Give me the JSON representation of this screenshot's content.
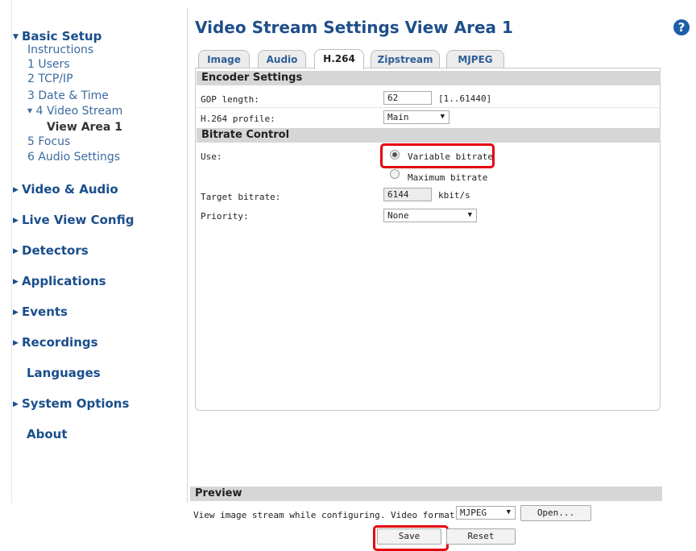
{
  "sidebar": {
    "basic_setup": "Basic Setup",
    "sub_items": [
      "Instructions",
      "1 Users",
      "2 TCP/IP",
      "3 Date & Time",
      "4 Video Stream",
      "View Area 1",
      "5 Focus",
      "6 Audio Settings"
    ],
    "sections": [
      "Video & Audio",
      "Live View Config",
      "Detectors",
      "Applications",
      "Events",
      "Recordings",
      "Languages",
      "System Options",
      "About"
    ]
  },
  "header": {
    "title": "Video Stream Settings View Area 1",
    "help": "?"
  },
  "tabs": [
    "Image",
    "Audio",
    "H.264",
    "Zipstream",
    "MJPEG"
  ],
  "active_tab": "H.264",
  "encoder": {
    "heading": "Encoder Settings",
    "gop_label": "GOP length:",
    "gop_value": "62",
    "gop_range": "[1..61440]",
    "profile_label": "H.264 profile:",
    "profile_value": "Main"
  },
  "bitrate": {
    "heading": "Bitrate Control",
    "use_label": "Use:",
    "variable_label": "Variable bitrate",
    "maximum_label": "Maximum bitrate",
    "selected": "Variable bitrate",
    "target_label": "Target bitrate:",
    "target_value": "6144",
    "target_unit": "kbit/s",
    "priority_label": "Priority:",
    "priority_value": "None"
  },
  "preview": {
    "heading": "Preview",
    "text": "View image stream while configuring.",
    "format_label": "Video format:",
    "format_value": "MJPEG",
    "open_label": "Open..."
  },
  "buttons": {
    "save": "Save",
    "reset": "Reset"
  },
  "colors": {
    "accent": "#1f4f8a",
    "highlight": "#e4000f"
  }
}
